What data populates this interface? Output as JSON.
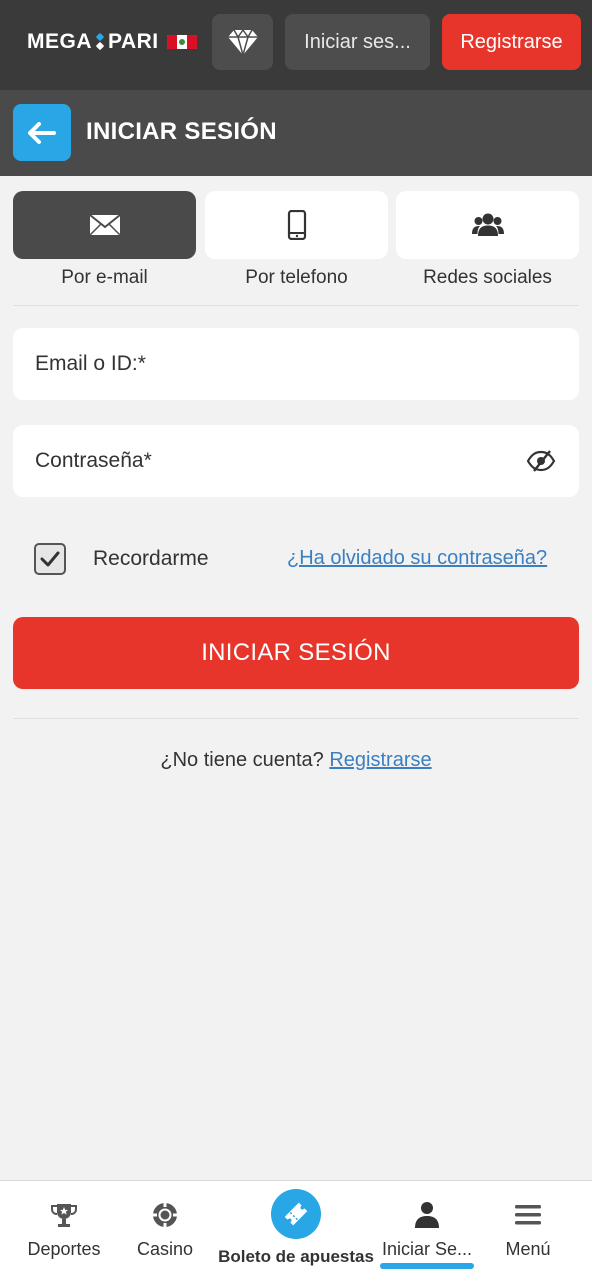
{
  "header": {
    "logo_left": "MEGA",
    "logo_right": "PARI",
    "login_button": "Iniciar ses...",
    "register_button": "Registrarse"
  },
  "title_bar": {
    "title": "INICIAR SESIÓN"
  },
  "login_methods": [
    {
      "label": "Por e-mail",
      "icon": "envelope-icon",
      "active": true
    },
    {
      "label": "Por telefono",
      "icon": "phone-icon",
      "active": false
    },
    {
      "label": "Redes sociales",
      "icon": "users-icon",
      "active": false
    }
  ],
  "form": {
    "email_placeholder": "Email o ID:*",
    "email_value": "",
    "password_placeholder": "Contraseña*",
    "password_value": "",
    "remember_label": "Recordarme",
    "remember_checked": true,
    "forgot_link": "¿Ha olvidado su contraseña?",
    "submit_label": "INICIAR SESIÓN"
  },
  "register_prompt": {
    "text": "¿No tiene cuenta?",
    "link": "Registrarse"
  },
  "bottom_nav": [
    {
      "label": "Deportes",
      "icon": "trophy-icon"
    },
    {
      "label": "Casino",
      "icon": "casino-chip-icon"
    },
    {
      "label": "Boleto de apuestas",
      "icon": "ticket-icon"
    },
    {
      "label": "Iniciar Se...",
      "icon": "user-icon",
      "active": true
    },
    {
      "label": "Menú",
      "icon": "hamburger-menu-icon"
    }
  ],
  "colors": {
    "accent_blue": "#29a6e5",
    "accent_red": "#e8352b",
    "header_bg": "#3a3a3a",
    "title_bg": "#4a4a4a",
    "page_bg": "#f2f2f2"
  }
}
